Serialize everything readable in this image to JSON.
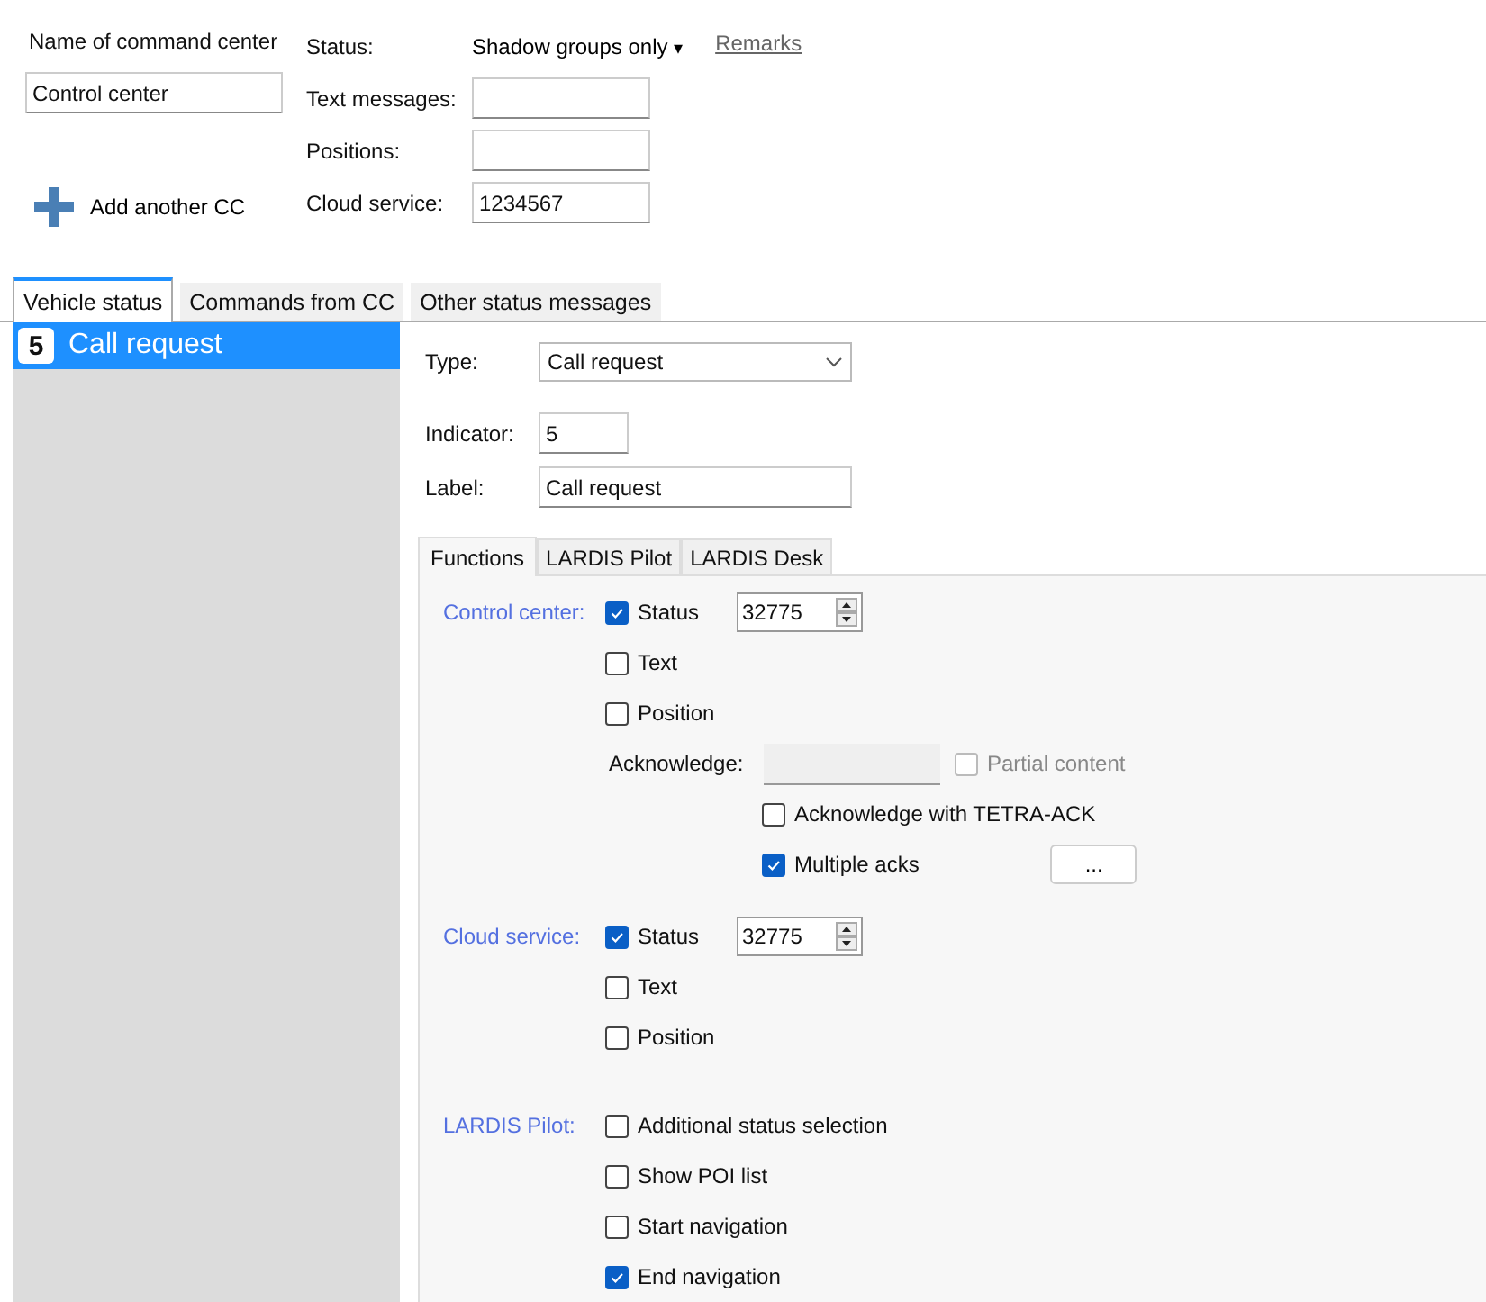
{
  "header": {
    "name_label": "Name of command center",
    "name_value": "Control center",
    "add_button": "Add another CC",
    "status_label": "Status:",
    "status_value": "Shadow groups only",
    "status_caret": "▾",
    "remarks_link": "Remarks",
    "fields": [
      {
        "label": "Text messages:"
      },
      {
        "label": "Positions:"
      },
      {
        "label": "Cloud service:",
        "value": "1234567"
      }
    ]
  },
  "tabs": [
    {
      "label": "Vehicle status",
      "selected": true
    },
    {
      "label": "Commands from CC",
      "selected": false
    },
    {
      "label": "Other status messages",
      "selected": false
    }
  ],
  "status_list": [
    {
      "indicator": "5",
      "label": "Call request",
      "selected": true
    }
  ],
  "detail": {
    "type_label": "Type:",
    "type_value": "Call request",
    "indicator_label": "Indicator:",
    "indicator_value": "5",
    "label_label": "Label:",
    "label_value": "Call request",
    "tabs": [
      {
        "label": "Functions",
        "selected": true
      },
      {
        "label": "LARDIS Pilot",
        "selected": false
      },
      {
        "label": "LARDIS Desk",
        "selected": false
      }
    ],
    "sections": [
      {
        "label": "Control center:",
        "items": [
          {
            "kind": "check",
            "label": "Status",
            "checked": true,
            "spin": "32775"
          },
          {
            "kind": "check",
            "label": "Text",
            "checked": false
          },
          {
            "kind": "check",
            "label": "Position",
            "checked": false
          },
          {
            "kind": "ack",
            "label": "Acknowledge:",
            "option": {
              "label": "Partial content",
              "checked": false,
              "disabled": true
            }
          },
          {
            "kind": "subcheck",
            "label": "Acknowledge with TETRA-ACK",
            "checked": false
          },
          {
            "kind": "subcheck",
            "label": "Multiple acks",
            "checked": true,
            "button": "..."
          }
        ]
      },
      {
        "label": "Cloud service:",
        "items": [
          {
            "kind": "check",
            "label": "Status",
            "checked": true,
            "spin": "32775"
          },
          {
            "kind": "check",
            "label": "Text",
            "checked": false
          },
          {
            "kind": "check",
            "label": "Position",
            "checked": false
          }
        ]
      },
      {
        "label": "LARDIS Pilot:",
        "items": [
          {
            "kind": "check",
            "label": "Additional status selection",
            "checked": false
          },
          {
            "kind": "check",
            "label": "Show POI list",
            "checked": false
          },
          {
            "kind": "check",
            "label": "Start navigation",
            "checked": false
          },
          {
            "kind": "check",
            "label": "End navigation",
            "checked": true
          }
        ]
      }
    ]
  }
}
